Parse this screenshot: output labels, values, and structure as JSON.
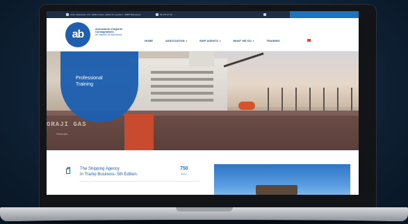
{
  "topbar": {
    "address": "Avda. Drassanes, 6-8 - Edifici Colom, planta 13, puerta 1 - 08001 Barcelona",
    "phone": "93 270 27 30"
  },
  "header": {
    "brand_mark": "ab",
    "brand_line1": "Associació d'Agents",
    "brand_line2": "Consignataris",
    "brand_line3": "de Vaixells de Barcelona"
  },
  "nav": {
    "items": [
      {
        "label": "HOME",
        "dropdown": false
      },
      {
        "label": "ASSOCIATION",
        "dropdown": true
      },
      {
        "label": "SHIP AGENTS",
        "dropdown": true
      },
      {
        "label": "WHAT WE DO",
        "dropdown": true
      },
      {
        "label": "TRAINING",
        "dropdown": false
      }
    ]
  },
  "hero": {
    "badge_line1": "Professional",
    "badge_line2": "Training",
    "hull_name": "ORAJI GAS",
    "hull_port": "PANAMA"
  },
  "content": {
    "title_line1": "The Shipping Agency",
    "title_line2": "In Tramp Business- 5th Edition.",
    "price": "750",
    "price_unit": "Euros"
  },
  "icons": {
    "location": "map-pin-icon",
    "phone": "phone-icon",
    "social": "linkedin-icon",
    "language": "spain-flag-icon",
    "doc": "document-icon"
  },
  "colors": {
    "brand_blue": "#1e5fae",
    "accent_blue": "#1e73be",
    "topbar": "#1c2f44",
    "nav_text": "#2a4f77"
  }
}
